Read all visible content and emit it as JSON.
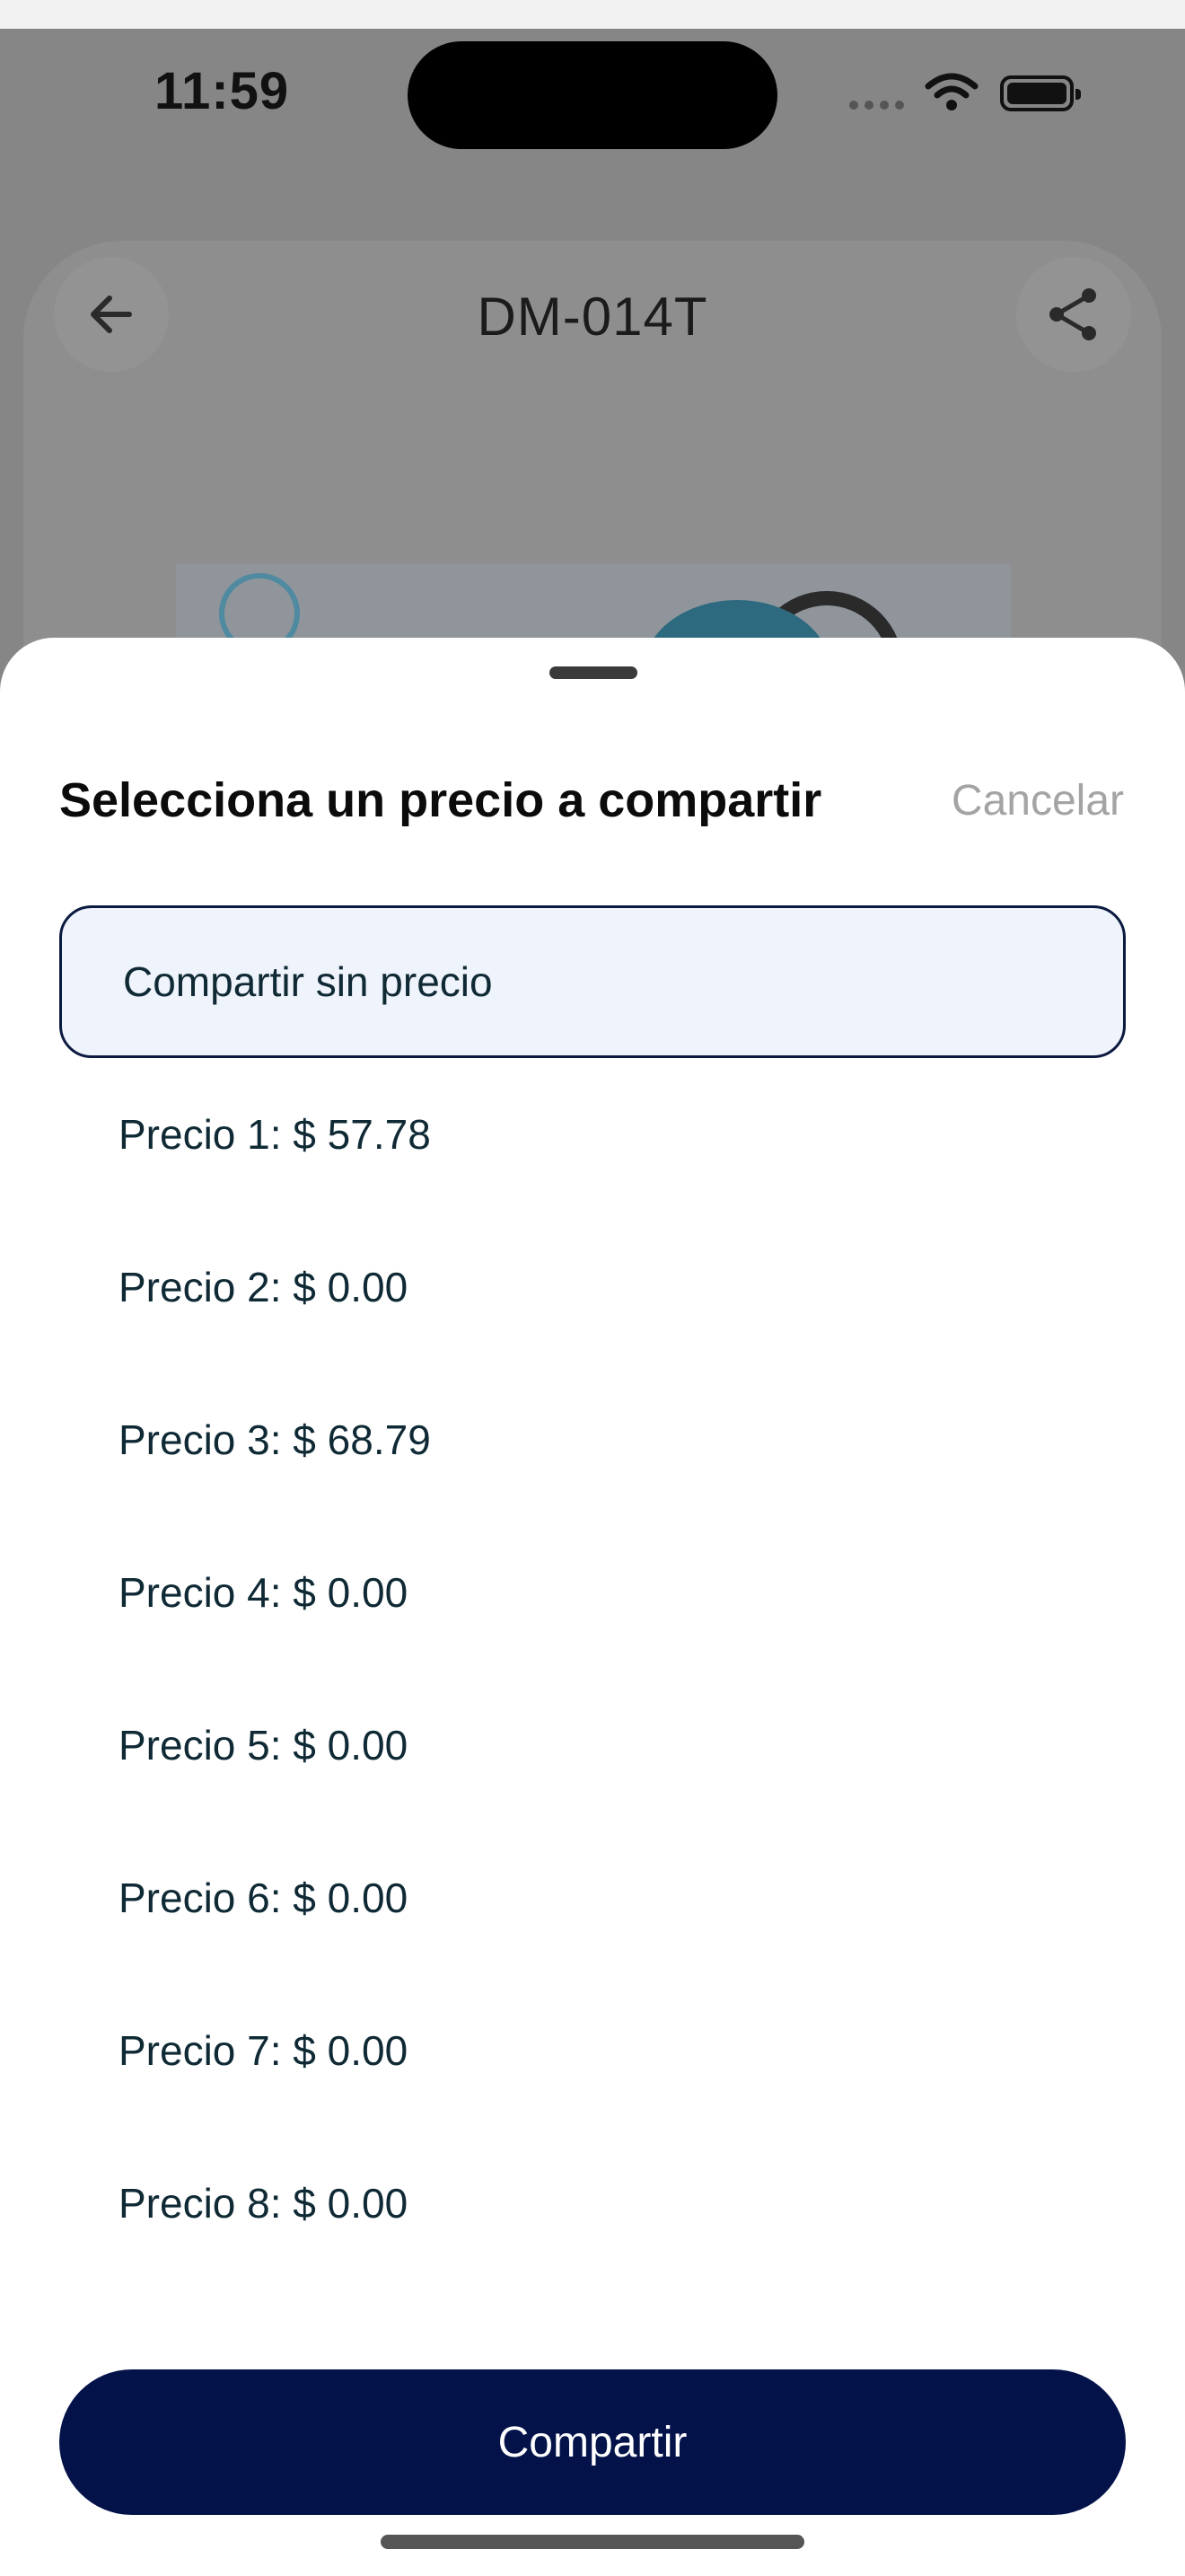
{
  "status_bar": {
    "time": "11:59"
  },
  "header": {
    "title": "DM-014T"
  },
  "sheet": {
    "title": "Selecciona un precio a compartir",
    "cancel_label": "Cancelar",
    "options": [
      {
        "label": "Compartir sin precio",
        "selected": true
      },
      {
        "label": "Precio 1: $ 57.78",
        "selected": false
      },
      {
        "label": "Precio 2: $ 0.00",
        "selected": false
      },
      {
        "label": "Precio 3: $ 68.79",
        "selected": false
      },
      {
        "label": "Precio 4: $ 0.00",
        "selected": false
      },
      {
        "label": "Precio 5: $ 0.00",
        "selected": false
      },
      {
        "label": "Precio 6: $ 0.00",
        "selected": false
      },
      {
        "label": "Precio 7: $ 0.00",
        "selected": false
      },
      {
        "label": "Precio 8: $ 0.00",
        "selected": false
      }
    ],
    "share_button_label": "Compartir"
  },
  "colors": {
    "primary": "#03134a",
    "selected_bg": "#eff3fb",
    "cancel_text": "#a4a4a4"
  }
}
